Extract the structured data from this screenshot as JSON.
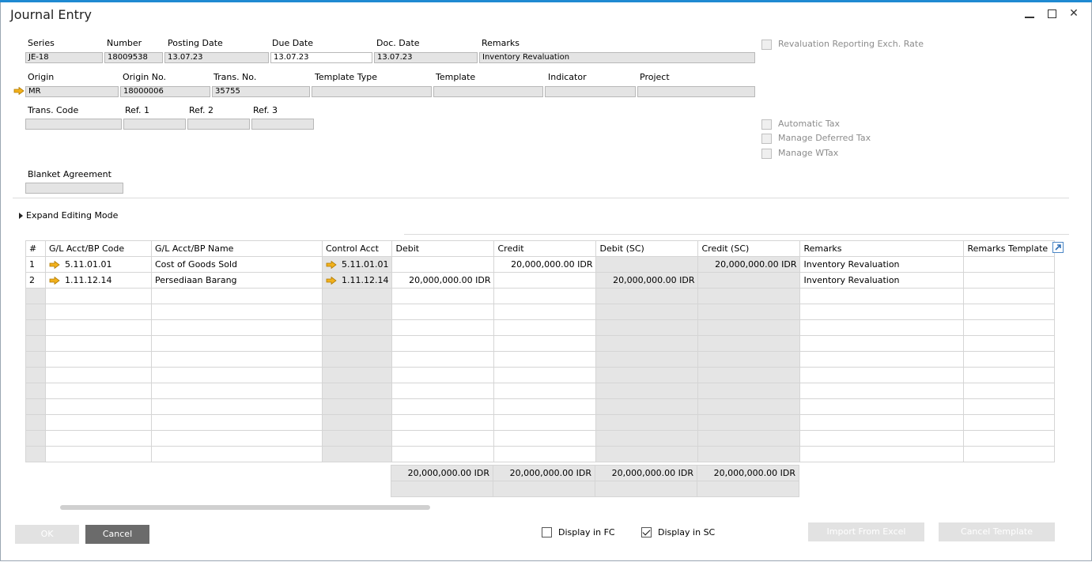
{
  "window": {
    "title": "Journal Entry"
  },
  "header": {
    "series_label": "Series",
    "series_value": "JE-18",
    "number_label": "Number",
    "number_value": "18009538",
    "posting_date_label": "Posting Date",
    "posting_date_value": "13.07.23",
    "due_date_label": "Due Date",
    "due_date_value": "13.07.23",
    "doc_date_label": "Doc. Date",
    "doc_date_value": "13.07.23",
    "remarks_label": "Remarks",
    "remarks_value": "Inventory Revaluation",
    "origin_label": "Origin",
    "origin_value": "MR",
    "origin_no_label": "Origin No.",
    "origin_no_value": "18000006",
    "trans_no_label": "Trans. No.",
    "trans_no_value": "35755",
    "template_type_label": "Template Type",
    "template_type_value": "",
    "template_label": "Template",
    "template_value": "",
    "indicator_label": "Indicator",
    "indicator_value": "",
    "project_label": "Project",
    "project_value": "",
    "trans_code_label": "Trans. Code",
    "trans_code_value": "",
    "ref1_label": "Ref. 1",
    "ref1_value": "",
    "ref2_label": "Ref. 2",
    "ref2_value": "",
    "ref3_label": "Ref. 3",
    "ref3_value": "",
    "blanket_agreement_label": "Blanket Agreement",
    "blanket_agreement_value": ""
  },
  "options": {
    "revaluation_reporting": "Revaluation Reporting Exch. Rate",
    "automatic_tax": "Automatic Tax",
    "manage_deferred_tax": "Manage Deferred Tax",
    "manage_wtax": "Manage WTax"
  },
  "expand_editing_mode": "Expand Editing Mode",
  "grid": {
    "columns": [
      "#",
      "G/L Acct/BP Code",
      "G/L Acct/BP Name",
      "Control Acct",
      "Debit",
      "Credit",
      "Debit (SC)",
      "Credit (SC)",
      "Remarks",
      "Remarks Template"
    ],
    "rows": [
      {
        "no": "1",
        "code": "5.11.01.01",
        "name": "Cost of Goods Sold",
        "control": "5.11.01.01",
        "debit": "",
        "credit": "20,000,000.00 IDR",
        "debit_sc": "",
        "credit_sc": "20,000,000.00 IDR",
        "remarks": "Inventory Revaluation",
        "remarks_template": ""
      },
      {
        "no": "2",
        "code": "1.11.12.14",
        "name": "Persediaan Barang",
        "control": "1.11.12.14",
        "debit": "20,000,000.00 IDR",
        "credit": "",
        "debit_sc": "20,000,000.00 IDR",
        "credit_sc": "",
        "remarks": "Inventory Revaluation",
        "remarks_template": ""
      }
    ],
    "totals": {
      "debit": "20,000,000.00 IDR",
      "credit": "20,000,000.00 IDR",
      "debit_sc": "20,000,000.00 IDR",
      "credit_sc": "20,000,000.00 IDR"
    }
  },
  "footer": {
    "ok": "OK",
    "cancel": "Cancel",
    "display_fc": "Display in FC",
    "display_fc_checked": false,
    "display_sc": "Display in SC",
    "display_sc_checked": true,
    "import_excel": "Import From Excel",
    "cancel_template": "Cancel Template"
  },
  "colors": {
    "accent": "#1f8ad2",
    "arrow": "#f2b11c",
    "disabled_button": "#e2e2e2",
    "cancel_button": "#6b6b6b"
  }
}
